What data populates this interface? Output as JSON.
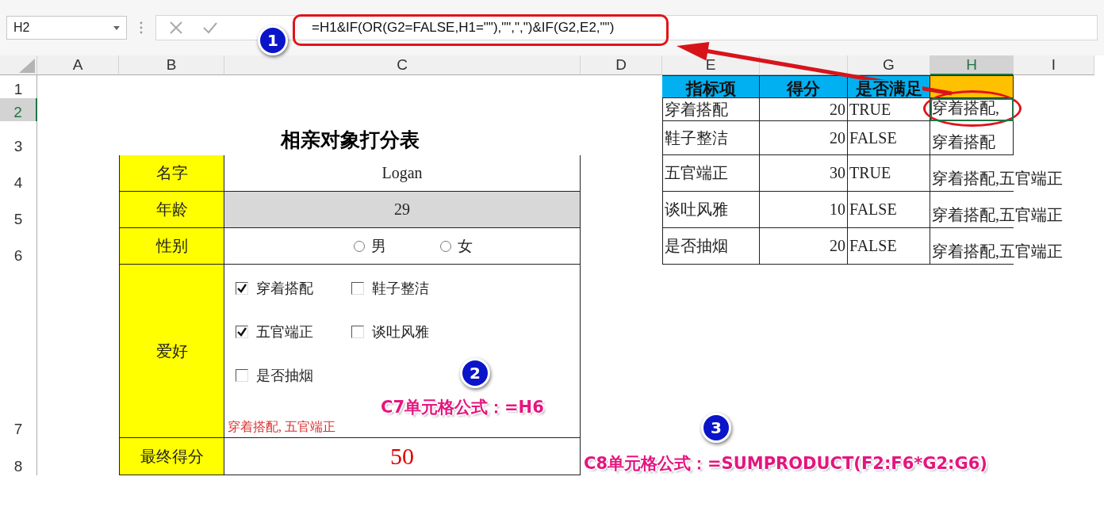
{
  "name_box": "H2",
  "formula": "=H1&IF(OR(G2=FALSE,H1=\"\"),\"\",\",\")&IF(G2,E2,\"\")",
  "columns": [
    {
      "label": "A",
      "selected": false
    },
    {
      "label": "B",
      "selected": false
    },
    {
      "label": "C",
      "selected": false
    },
    {
      "label": "D",
      "selected": false
    },
    {
      "label": "E",
      "selected": false
    },
    {
      "selected": false
    },
    {
      "label": "G",
      "selected": false
    },
    {
      "label": "H",
      "selected": true
    },
    {
      "label": "I",
      "selected": false
    }
  ],
  "rows": [
    {
      "label": "1",
      "selected": false
    },
    {
      "label": "2",
      "selected": true
    },
    {
      "label": "3",
      "selected": false
    },
    {
      "label": "4",
      "selected": false
    },
    {
      "label": "5",
      "selected": false
    },
    {
      "label": "6",
      "selected": false
    },
    {
      "label": "7",
      "selected": false
    },
    {
      "label": "8",
      "selected": false
    }
  ],
  "form": {
    "title": "相亲对象打分表",
    "fields": [
      {
        "label": "名字",
        "kind": "text",
        "value": "Logan"
      },
      {
        "label": "年龄",
        "kind": "shaded",
        "value": "29"
      },
      {
        "label": "性别",
        "kind": "radio",
        "options": [
          {
            "label": "男",
            "selected": false
          },
          {
            "label": "女",
            "selected": false
          }
        ]
      },
      {
        "label": "爱好",
        "kind": "checkboxes",
        "options": [
          {
            "label": "穿着搭配",
            "checked": true
          },
          {
            "label": "鞋子整洁",
            "checked": false
          },
          {
            "label": "五官端正",
            "checked": true
          },
          {
            "label": "谈吐风雅",
            "checked": false
          },
          {
            "label": "是否抽烟",
            "checked": false
          }
        ],
        "result": "穿着搭配, 五官端正"
      },
      {
        "label": "最终得分",
        "kind": "score",
        "value": "50"
      }
    ]
  },
  "table": {
    "headers": [
      "指标项",
      "得分",
      "是否满足"
    ],
    "rows": [
      {
        "item": "穿着搭配",
        "score": "20",
        "met": "TRUE",
        "joined": "穿着搭配,"
      },
      {
        "item": "鞋子整洁",
        "score": "20",
        "met": "FALSE",
        "joined": "穿着搭配"
      },
      {
        "item": "五官端正",
        "score": "30",
        "met": "TRUE",
        "joined": "穿着搭配,五官端正"
      },
      {
        "item": "谈吐风雅",
        "score": "10",
        "met": "FALSE",
        "joined": "穿着搭配,五官端正"
      },
      {
        "item": "是否抽烟",
        "score": "20",
        "met": "FALSE",
        "joined": "穿着搭配,五官端正"
      }
    ]
  },
  "annotations": [
    {
      "number": "1"
    },
    {
      "number": "2",
      "text": "C7单元格公式：=H6"
    },
    {
      "number": "3",
      "text": "C8单元格公式：=SUMPRODUCT(F2:F6*G2:G6)"
    }
  ]
}
